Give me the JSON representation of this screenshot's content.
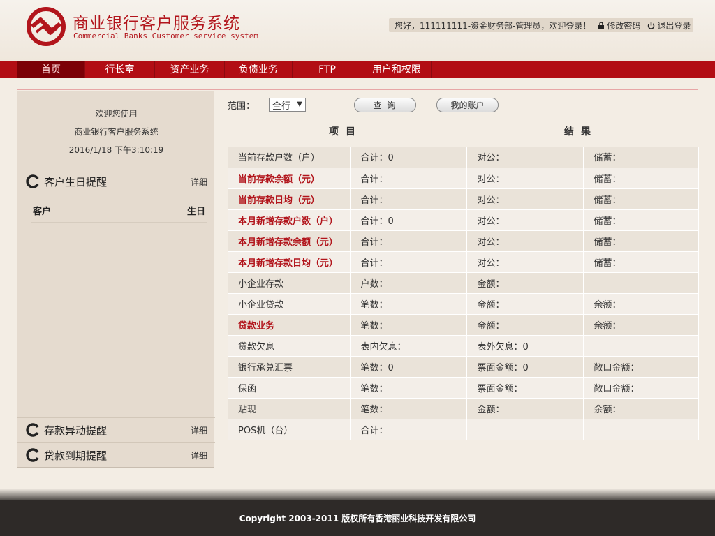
{
  "header": {
    "brand_cn": "商业银行客户服务系统",
    "brand_en": "Commercial Banks Customer service system",
    "user_greeting": "您好，111111111-资金财务部-管理员，欢迎登录！",
    "change_password": "修改密码",
    "logout": "退出登录",
    "lock_icon": "lock-icon",
    "power_icon": "power-icon",
    "brand_color": "#b2151c"
  },
  "nav": {
    "items": [
      {
        "label": "首页",
        "active": true
      },
      {
        "label": "行长室"
      },
      {
        "label": "资产业务"
      },
      {
        "label": "负债业务"
      },
      {
        "label": "FTP"
      },
      {
        "label": "用户和权限"
      }
    ]
  },
  "sidebar": {
    "welcome1": "欢迎您使用",
    "welcome2": "商业银行客户服务系统",
    "datetime": "2016/1/18 下午3:10:19",
    "birthday": {
      "title": "客户生日提醒",
      "detail": "详细",
      "col_customer": "客户",
      "col_birthday": "生日"
    },
    "deposit_alert": {
      "title": "存款异动提醒",
      "detail": "详细"
    },
    "loan_alert": {
      "title": "贷款到期提醒",
      "detail": "详细"
    }
  },
  "main": {
    "scope_label": "范围：",
    "scope_value": "全行",
    "query_button": "查 询",
    "my_account_button": "我的账户",
    "col_item": "项目",
    "col_result": "结果",
    "rows": [
      {
        "c1": "当前存款户数（户）",
        "c2": "合计：0",
        "c3": "对公：",
        "c4": "储蓄：",
        "hl": false
      },
      {
        "c1": "当前存款余额（元）",
        "c2": "合计：",
        "c3": "对公：",
        "c4": "储蓄：",
        "hl": true
      },
      {
        "c1": "当前存款日均（元）",
        "c2": "合计：",
        "c3": "对公：",
        "c4": "储蓄：",
        "hl": true
      },
      {
        "c1": "本月新增存款户数（户）",
        "c2": "合计：0",
        "c3": "对公：",
        "c4": "储蓄：",
        "hl": true
      },
      {
        "c1": "本月新增存款余额（元）",
        "c2": "合计：",
        "c3": "对公：",
        "c4": "储蓄：",
        "hl": true
      },
      {
        "c1": "本月新增存款日均（元）",
        "c2": "合计：",
        "c3": "对公：",
        "c4": "储蓄：",
        "hl": true
      },
      {
        "c1": "小企业存款",
        "c2": "户数：",
        "c3": "金额：",
        "c4": "",
        "hl": false
      },
      {
        "c1": "小企业贷款",
        "c2": "笔数：",
        "c3": "金额：",
        "c4": "余额：",
        "hl": false
      },
      {
        "c1": "贷款业务",
        "c2": "笔数：",
        "c3": "金额：",
        "c4": "余额：",
        "hl": true
      },
      {
        "c1": "贷款欠息",
        "c2": "表内欠息：",
        "c3": "表外欠息：0",
        "c4": "",
        "hl": false
      },
      {
        "c1": "银行承兑汇票",
        "c2": "笔数：0",
        "c3": "票面金额：0",
        "c4": "敞口金额：",
        "hl": false
      },
      {
        "c1": "保函",
        "c2": "笔数：",
        "c3": "票面金额：",
        "c4": "敞口金额：",
        "hl": false
      },
      {
        "c1": "贴现",
        "c2": "笔数：",
        "c3": "金额：",
        "c4": "余额：",
        "hl": false
      },
      {
        "c1": "POS机（台）",
        "c2": "合计：",
        "c3": "",
        "c4": "",
        "hl": false
      }
    ]
  },
  "footer": {
    "copyright": "Copyright 2003-2011 版权所有香港丽业科技开发有限公司"
  }
}
